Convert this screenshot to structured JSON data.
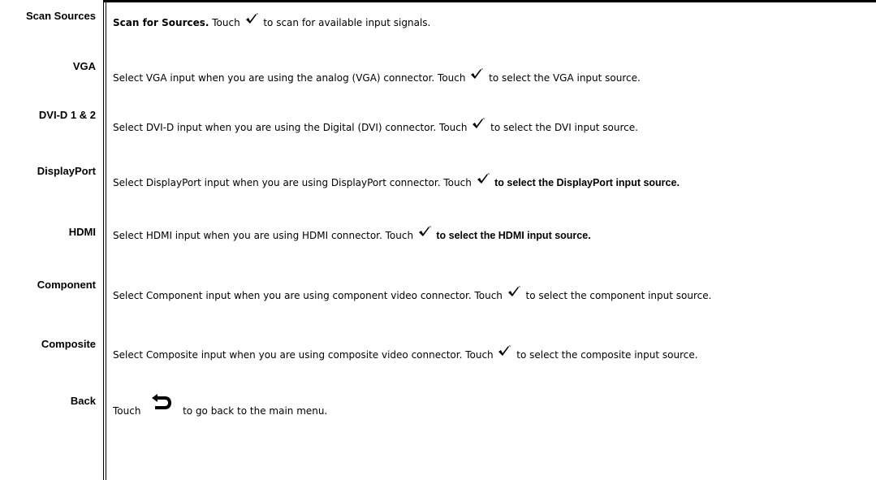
{
  "rows": [
    {
      "label": "Scan Sources",
      "lead": "Scan for Sources.",
      "pre": " Touch ",
      "post": " to scan for available input signals.",
      "icon": "check-icon"
    },
    {
      "label": "VGA",
      "pre": "Select VGA input when you are using the analog (VGA) connector. Touch ",
      "post": " to select the VGA input source.",
      "icon": "check-icon"
    },
    {
      "label": "DVI-D 1 & 2",
      "pre": "Select DVI-D input when you are using the Digital (DVI) connector. Touch ",
      "post": " to select the DVI input source.",
      "icon": "check-icon"
    },
    {
      "label": "DisplayPort",
      "pre": "Select DisplayPort input when you are using DisplayPort connector. Touch ",
      "post": " to select the DisplayPort input source.",
      "icon": "check-icon"
    },
    {
      "label": "HDMI",
      "pre": "Select HDMI input when you are using HDMI connector. Touch ",
      "post": " to select the HDMI input source.",
      "icon": "check-icon"
    },
    {
      "label": "Component",
      "pre": "Select Component input when you are using component video connector. Touch ",
      "post": " to select the component input source.",
      "icon": "check-icon"
    },
    {
      "label": "Composite",
      "pre": "Select Composite input when you are using composite video connector. Touch ",
      "post": " to select the composite input source.",
      "icon": "check-icon"
    },
    {
      "label": "Back",
      "pre": "Touch ",
      "post": " to go back to the main menu.",
      "icon": "back-arrow-icon"
    }
  ]
}
